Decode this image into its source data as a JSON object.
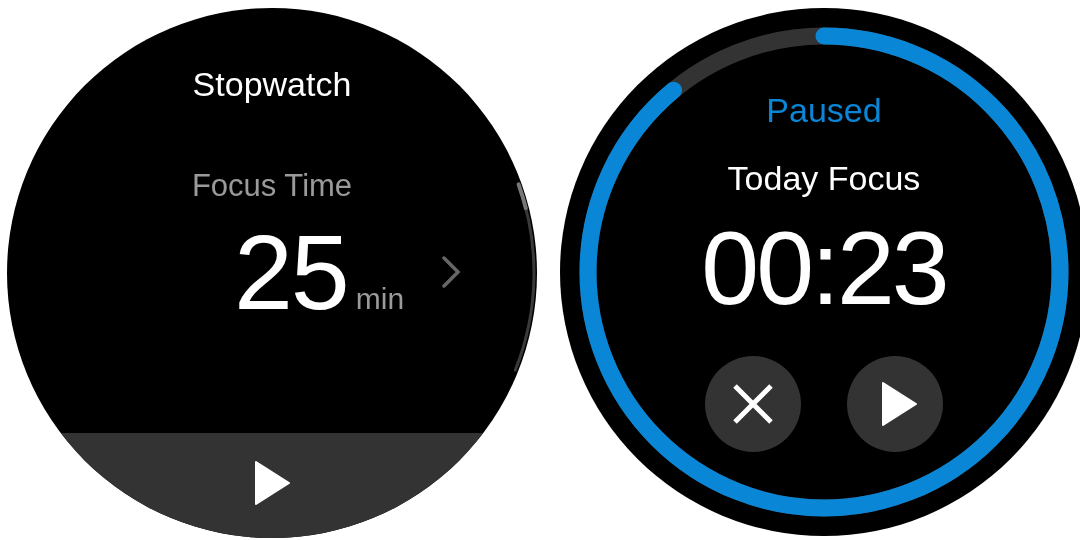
{
  "screens": [
    {
      "kind": "setup",
      "title": "Stopwatch",
      "label": "Focus Time",
      "value": "25",
      "unit": "min"
    },
    {
      "kind": "timer",
      "status": "Paused",
      "label": "Today Focus",
      "time": "00:23",
      "progress": {
        "level": 0.89
      },
      "buttons": [
        {
          "kind": "cancel"
        },
        {
          "kind": "play"
        }
      ]
    }
  ]
}
